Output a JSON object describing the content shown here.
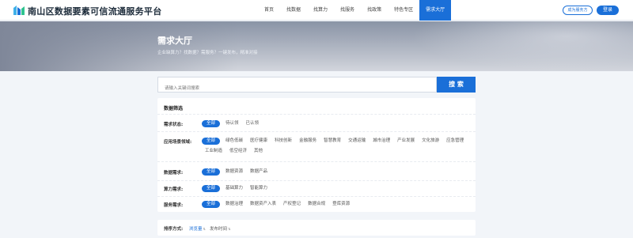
{
  "header": {
    "title": "南山区数据要素可信流通服务平台",
    "nav": [
      {
        "label": "首页",
        "active": false
      },
      {
        "label": "找数据",
        "active": false
      },
      {
        "label": "找算力",
        "active": false
      },
      {
        "label": "找服务",
        "active": false
      },
      {
        "label": "找政策",
        "active": false
      },
      {
        "label": "特色专区",
        "active": false
      },
      {
        "label": "需求大厅",
        "active": true
      }
    ],
    "provider_button": "成为服务方",
    "login_button": "登录"
  },
  "hero": {
    "title": "需求大厅",
    "subtitle": "企业缺算力？找数据？需服务？一键发布，精准对接"
  },
  "search": {
    "placeholder": "请输入关键词搜索",
    "button": "搜 索"
  },
  "filters": {
    "title": "数据筛选",
    "rows": [
      {
        "label": "需求状态:",
        "tags": [
          "全部",
          "待认领",
          "已认领"
        ]
      },
      {
        "label": "应用场景领域:",
        "tags": [
          "全部",
          "绿色低碳",
          "医疗健康",
          "科技创新",
          "金融服务",
          "智慧教育",
          "交通运输",
          "城市治理",
          "产业发展",
          "文化旅游",
          "应急管理",
          "工业制造",
          "低空经济",
          "其他"
        ]
      },
      {
        "label": "数据需求:",
        "tags": [
          "全部",
          "数据资源",
          "数据产品"
        ]
      },
      {
        "label": "算力需求:",
        "tags": [
          "全部",
          "基础算力",
          "智能算力"
        ]
      },
      {
        "label": "服务需求:",
        "tags": [
          "全部",
          "数据治理",
          "数据资产入表",
          "产权登记",
          "数据合规",
          "登库资源"
        ]
      }
    ]
  },
  "sort": {
    "label": "排序方式:",
    "options": [
      {
        "label": "浏览量",
        "active": true
      },
      {
        "label": "发布时间",
        "active": false
      }
    ]
  },
  "colors": {
    "primary": "#1a6fd8",
    "background": "#f2f5f9"
  }
}
